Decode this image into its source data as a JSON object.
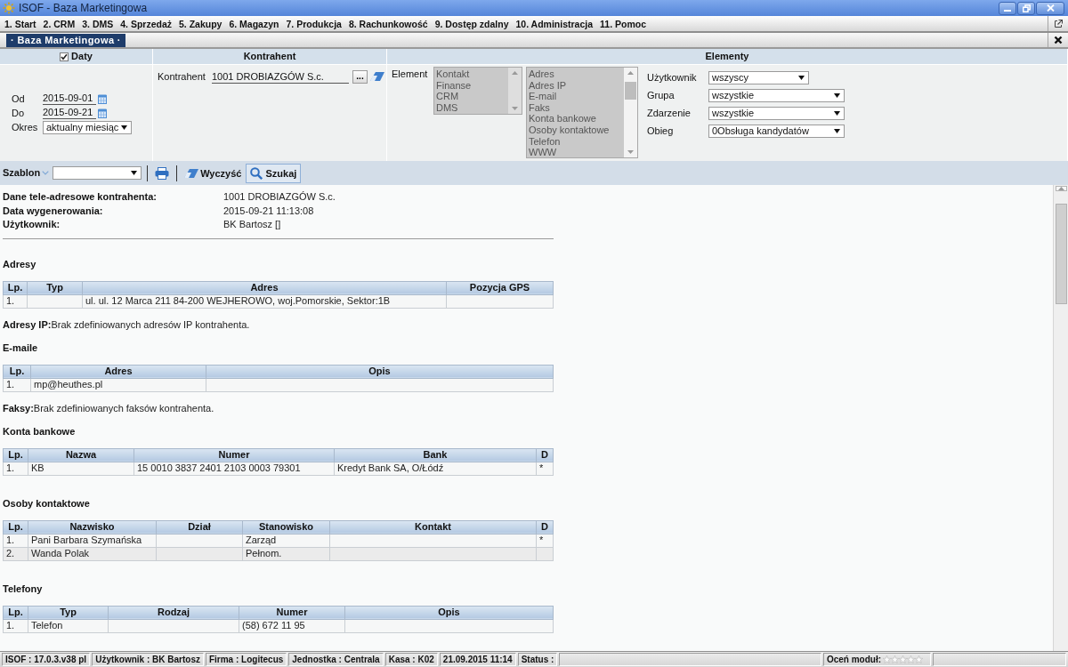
{
  "window": {
    "title": "ISOF - Baza Marketingowa"
  },
  "menu": [
    "1. Start",
    "2. CRM",
    "3. DMS",
    "4. Sprzedaż",
    "5. Zakupy",
    "6. Magazyn",
    "7. Produkcja",
    "8. Rachunkowość",
    "9. Dostęp zdalny",
    "10. Administracja",
    "11. Pomoc"
  ],
  "tabs": [
    {
      "label": "· Baza Marketingowa ·",
      "selected": true
    }
  ],
  "filters": {
    "dates": {
      "title": "Daty",
      "checked": true,
      "fields": [
        {
          "kind": "date",
          "label": "Od",
          "value": "2015-09-01"
        },
        {
          "kind": "date",
          "label": "Do",
          "value": "2015-09-21"
        },
        {
          "kind": "select",
          "label": "Okres",
          "value": "aktualny miesiąc"
        }
      ]
    },
    "contractor": {
      "title": "Kontrahent",
      "label": "Kontrahent",
      "value": "1001 DROBIAZGÓW S.c.",
      "browse_button": "..."
    },
    "elements": {
      "title": "Elementy",
      "label": "Element",
      "lists": [
        {
          "disabled": true,
          "items": [
            "Kontakt",
            "Finanse",
            "CRM",
            "DMS"
          ]
        },
        {
          "disabled": true,
          "items": [
            "Adres",
            "Adres IP",
            "E-mail",
            "Faks",
            "Konta bankowe",
            "Osoby kontaktowe",
            "Telefon",
            "WWW"
          ]
        }
      ],
      "fields": [
        {
          "label": "Użytkownik",
          "value": "wszyscy"
        },
        {
          "label": "Grupa",
          "value": "wszystkie"
        },
        {
          "label": "Zdarzenie",
          "value": "wszystkie"
        },
        {
          "label": "Obieg",
          "value": "0Obsługa kandydatów"
        }
      ]
    }
  },
  "toolbar": {
    "template_label": "Szablon",
    "clear_button": "Wyczyść",
    "search_button": "Szukaj"
  },
  "report": {
    "info": [
      {
        "label": "Dane tele-adresowe kontrahenta:",
        "value": "1001 DROBIAZGÓW S.c."
      },
      {
        "label": "Data wygenerowania:",
        "value": "2015-09-21 11:13:08"
      },
      {
        "label": "Użytkownik:",
        "value": "BK Bartosz []"
      }
    ],
    "sections": [
      {
        "kind": "table",
        "title": "Adresy",
        "columns": [
          "Lp.",
          "Typ",
          "Adres",
          "Pozycja GPS"
        ],
        "rows": [
          [
            "1.",
            null,
            "ul. ul. 12 Marca 211 84-200 WEJHEROWO, woj.Pomorskie, Sektor:1B",
            null
          ]
        ]
      },
      {
        "kind": "note",
        "text": "**Adresy IP:**Brak zdefiniowanych adresów IP kontrahenta."
      },
      {
        "kind": "table",
        "title": "E-maile",
        "columns": [
          "Lp.",
          "Adres",
          "Opis"
        ],
        "rows": [
          [
            "1.",
            "mp@heuthes.pl",
            null
          ]
        ]
      },
      {
        "kind": "note",
        "text": "**Faksy:**Brak zdefiniowanych faksów kontrahenta."
      },
      {
        "kind": "table",
        "title": "Konta bankowe",
        "columns": [
          "Lp.",
          "Nazwa",
          "Numer",
          "Bank",
          "D"
        ],
        "rows": [
          [
            "1.",
            "KB",
            "15 0010 3837 2401 2103 0003 79301",
            "Kredyt Bank SA, O/Łódź",
            "*"
          ]
        ]
      },
      {
        "kind": "table",
        "title": "Osoby kontaktowe",
        "columns": [
          "Lp.",
          "Nazwisko",
          "Dział",
          "Stanowisko",
          "Kontakt",
          "D"
        ],
        "rows": [
          [
            "1.",
            "Pani Barbara Szymańska",
            null,
            "Zarząd",
            null,
            "*"
          ],
          [
            "2.",
            "Wanda Polak",
            null,
            "Pełnom.",
            null,
            null
          ]
        ]
      },
      {
        "kind": "table",
        "title": "Telefony",
        "columns": [
          "Lp.",
          "Typ",
          "Rodzaj",
          "Numer",
          "Opis"
        ],
        "rows": [
          [
            "1.",
            "Telefon",
            null,
            "(58) 672 11 95",
            null
          ]
        ]
      }
    ]
  },
  "status_bar": {
    "fields": [
      "ISOF : 17.0.3.v38 pl",
      "Użytkownik : BK Bartosz",
      "Firma : Logitecus",
      "Jednostka : Centrala",
      "Kasa : K02",
      "21.09.2015 11:14",
      "Status :"
    ],
    "rating": {
      "label": "Oceń moduł:",
      "stars": 0
    }
  }
}
